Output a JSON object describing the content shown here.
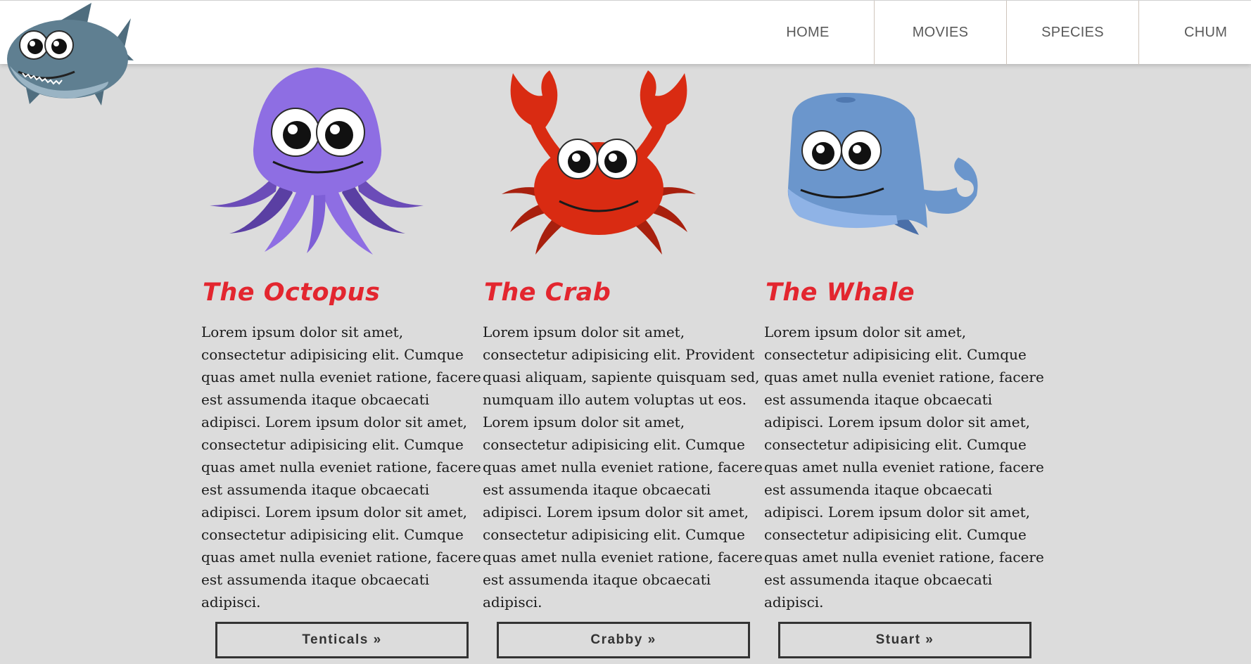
{
  "nav": {
    "items": [
      "HOME",
      "MOVIES",
      "SPECIES",
      "CHUM"
    ]
  },
  "cards": [
    {
      "title": "The Octopus",
      "body": "Lorem ipsum dolor sit amet, consectetur adipisicing elit. Cumque quas amet nulla eveniet ratione, facere est assumenda itaque obcaecati adipisci. Lorem ipsum dolor sit amet, consectetur adipisicing elit. Cumque quas amet nulla eveniet ratione, facere est assumenda itaque obcaecati adipisci. Lorem ipsum dolor sit amet, consectetur adipisicing elit. Cumque quas amet nulla eveniet ratione, facere est assumenda itaque obcaecati adipisci.",
      "button": "Tenticals »"
    },
    {
      "title": "The Crab",
      "body": "Lorem ipsum dolor sit amet, consectetur adipisicing elit. Provident quasi aliquam, sapiente quisquam sed, numquam illo autem voluptas ut eos. Lorem ipsum dolor sit amet, consectetur adipisicing elit. Cumque quas amet nulla eveniet ratione, facere est assumenda itaque obcaecati adipisci. Lorem ipsum dolor sit amet, consectetur adipisicing elit. Cumque quas amet nulla eveniet ratione, facere est assumenda itaque obcaecati adipisci.",
      "button": "Crabby »"
    },
    {
      "title": "The Whale",
      "body": "Lorem ipsum dolor sit amet, consectetur adipisicing elit. Cumque quas amet nulla eveniet ratione, facere est assumenda itaque obcaecati adipisci. Lorem ipsum dolor sit amet, consectetur adipisicing elit. Cumque quas amet nulla eveniet ratione, facere est assumenda itaque obcaecati adipisci. Lorem ipsum dolor sit amet, consectetur adipisicing elit. Cumque quas amet nulla eveniet ratione, facere est assumenda itaque obcaecati adipisci.",
      "button": "Stuart »"
    }
  ],
  "colors": {
    "title_red": "#e3262f",
    "octopus": "#8e6ee3",
    "crab": "#d92b12",
    "whale": "#6b96cc",
    "shark": "#5d7b8c"
  },
  "icons": [
    "shark-logo-icon",
    "octopus-icon",
    "crab-icon",
    "whale-icon"
  ]
}
